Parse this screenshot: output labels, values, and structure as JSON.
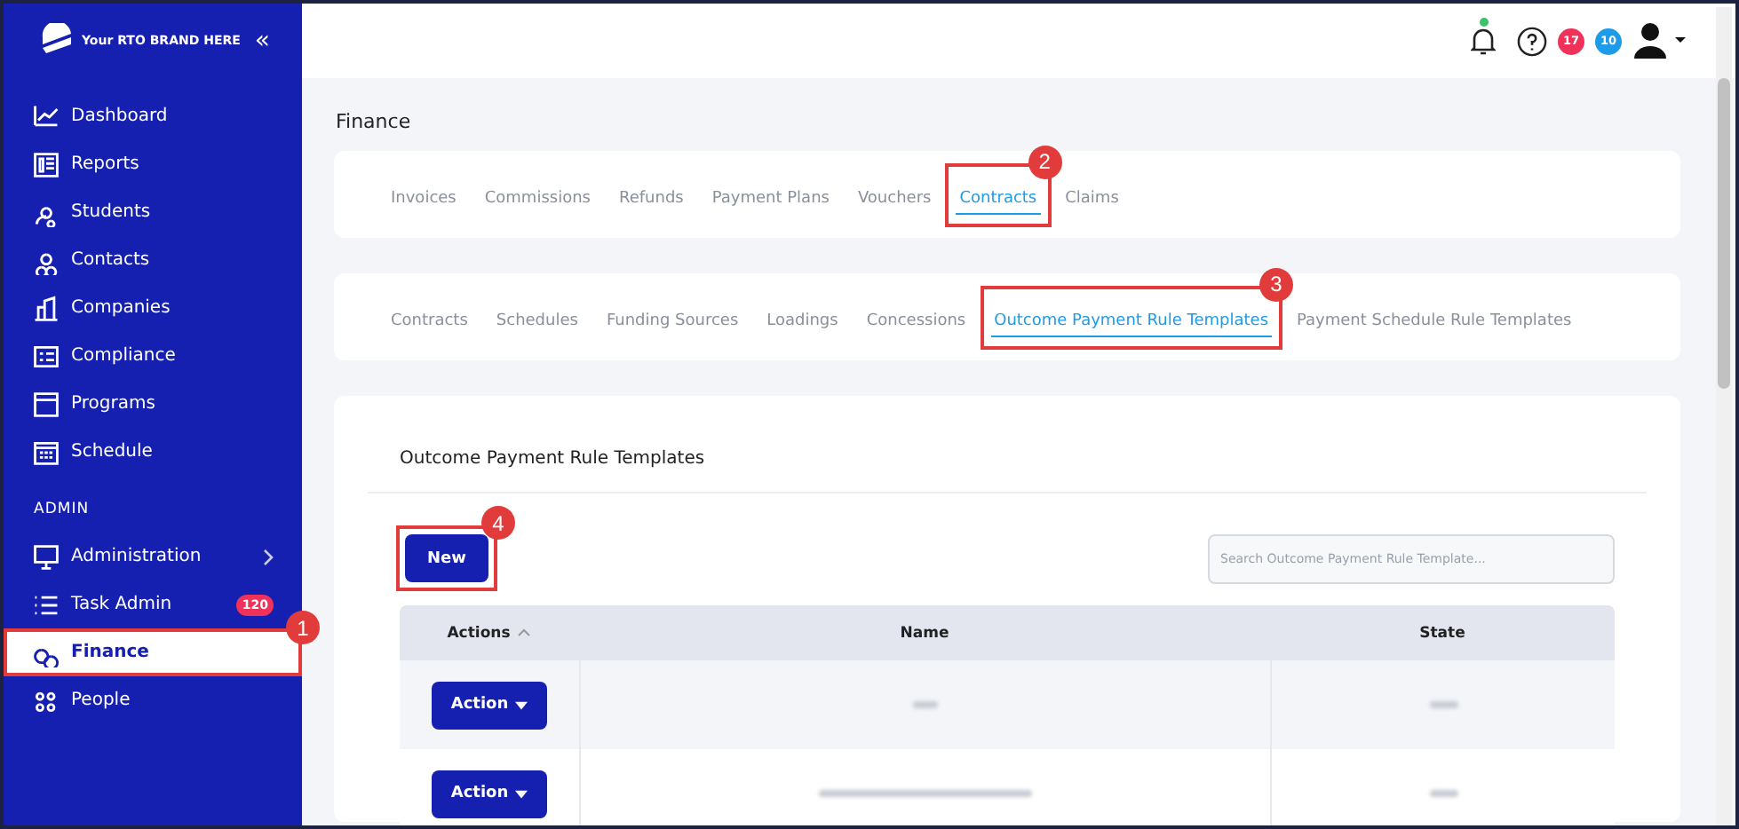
{
  "brand": {
    "name": "Your RTO BRAND HERE",
    "collapse": "«"
  },
  "sidebar": {
    "items": [
      {
        "label": "Dashboard",
        "kind": "chart",
        "selected": false
      },
      {
        "label": "Reports",
        "kind": "report",
        "selected": false
      },
      {
        "label": "Students",
        "kind": "students",
        "selected": false
      },
      {
        "label": "Contacts",
        "kind": "contacts",
        "selected": false
      },
      {
        "label": "Companies",
        "kind": "building",
        "selected": false
      },
      {
        "label": "Compliance",
        "kind": "list",
        "selected": false
      },
      {
        "label": "Programs",
        "kind": "window",
        "selected": false
      },
      {
        "label": "Schedule",
        "kind": "calendar",
        "selected": false
      }
    ],
    "section": "ADMIN",
    "admin_items": [
      {
        "label": "Administration",
        "kind": "monitor",
        "selected": false,
        "expandable": true
      },
      {
        "label": "Task Admin",
        "kind": "tasks",
        "selected": false,
        "badge": "120"
      },
      {
        "label": "Finance",
        "kind": "coins",
        "selected": true,
        "callout": "1"
      },
      {
        "label": "People",
        "kind": "people",
        "selected": false
      }
    ]
  },
  "topbar": {
    "notification_dot": true,
    "badges": [
      {
        "text": "17",
        "color": "#f0325a"
      },
      {
        "text": "10",
        "color": "#1e9be8"
      }
    ]
  },
  "page_title": "Finance",
  "tabs": [
    {
      "label": "Invoices",
      "selected": false
    },
    {
      "label": "Commissions",
      "selected": false
    },
    {
      "label": "Refunds",
      "selected": false
    },
    {
      "label": "Payment Plans",
      "selected": false
    },
    {
      "label": "Vouchers",
      "selected": false
    },
    {
      "label": "Contracts",
      "selected": true,
      "callout": "2"
    },
    {
      "label": "Claims",
      "selected": false
    }
  ],
  "subtabs": [
    {
      "label": "Contracts",
      "selected": false
    },
    {
      "label": "Schedules",
      "selected": false
    },
    {
      "label": "Funding Sources",
      "selected": false
    },
    {
      "label": "Loadings",
      "selected": false
    },
    {
      "label": "Concessions",
      "selected": false
    },
    {
      "label": "Outcome Payment Rule Templates",
      "selected": true,
      "callout": "3"
    },
    {
      "label": "Payment Schedule Rule Templates",
      "selected": false
    }
  ],
  "panel": {
    "title": "Outcome Payment Rule Templates",
    "new_button": {
      "label": "New",
      "callout": "4"
    },
    "search": {
      "placeholder": "Search Outcome Payment Rule Template..."
    },
    "table": {
      "columns": [
        {
          "label": "Actions",
          "sorted": true
        },
        {
          "label": "Name"
        },
        {
          "label": "State"
        }
      ],
      "rows": [
        {
          "action": "Action"
        },
        {
          "action": "Action"
        }
      ]
    }
  }
}
